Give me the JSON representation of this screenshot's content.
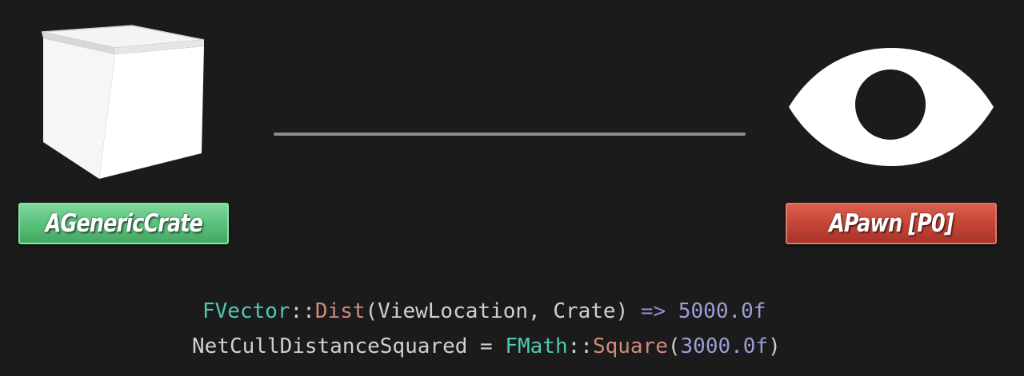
{
  "nodes": {
    "crate": {
      "label": "AGenericCrate",
      "icon": "cube-icon",
      "color": "#5cc37e"
    },
    "pawn": {
      "label": "APawn [P0]",
      "icon": "eye-icon",
      "color": "#c84737"
    }
  },
  "code": {
    "line1": {
      "type": "FVector",
      "sep": "::",
      "fn": "Dist",
      "args": "(ViewLocation, Crate)",
      "arrow": " => ",
      "result": "5000.0f"
    },
    "line2": {
      "lhs": "NetCullDistanceSquared",
      "assign": " = ",
      "type": "FMath",
      "sep": "::",
      "fn": "Square",
      "open": "(",
      "arg": "3000.0f",
      "close": ")"
    }
  },
  "colors": {
    "background": "#1b1b1b",
    "connector": "#8c8c8c",
    "code_type": "#4ec9b0",
    "code_function": "#d18a7b",
    "code_number": "#9d9dd9"
  }
}
